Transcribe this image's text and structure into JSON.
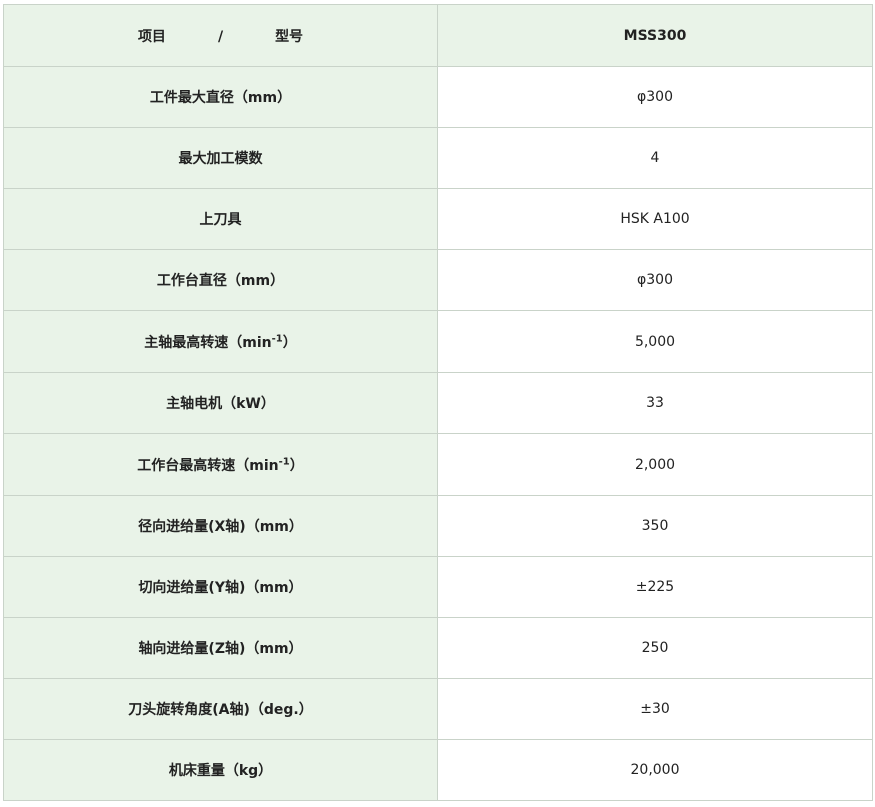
{
  "table": {
    "header": {
      "item": "项目",
      "slash": "/",
      "model_label": "型号",
      "model": "MSS300"
    },
    "rows": [
      {
        "label": "工件最大直径（mm）",
        "value": "φ300"
      },
      {
        "label": "最大加工模数",
        "value": "4"
      },
      {
        "label": "上刀具",
        "value": "HSK A100"
      },
      {
        "label": "工作台直径（mm）",
        "value": "φ300"
      },
      {
        "label_pre": "主轴最高转速（min",
        "label_sup": "-1",
        "label_post": "）",
        "value": "5,000"
      },
      {
        "label": "主轴电机（kW）",
        "value": "33"
      },
      {
        "label_pre": "工作台最高转速（min",
        "label_sup": "-1",
        "label_post": "）",
        "value": "2,000"
      },
      {
        "label": "径向进给量(X轴)（mm）",
        "value": "350"
      },
      {
        "label": "切向进给量(Y轴)（mm）",
        "value": "±225"
      },
      {
        "label": "轴向进给量(Z轴)（mm）",
        "value": "250"
      },
      {
        "label": "刀头旋转角度(A轴)（deg.）",
        "value": "±30"
      },
      {
        "label": "机床重量（kg）",
        "value": "20,000"
      }
    ]
  }
}
